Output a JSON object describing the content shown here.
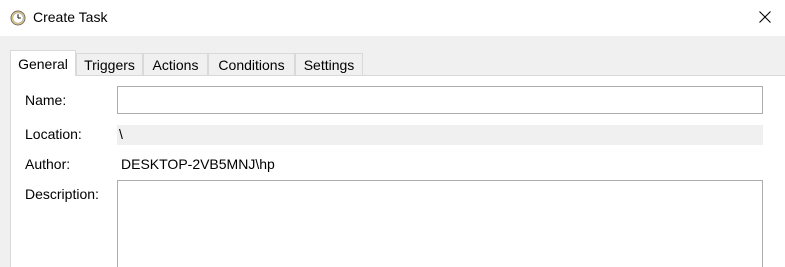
{
  "window": {
    "title": "Create Task",
    "icon": "task-scheduler-clock-icon",
    "close_icon": "close-icon"
  },
  "tabs": [
    {
      "label": "General",
      "active": true
    },
    {
      "label": "Triggers",
      "active": false
    },
    {
      "label": "Actions",
      "active": false
    },
    {
      "label": "Conditions",
      "active": false
    },
    {
      "label": "Settings",
      "active": false
    }
  ],
  "general": {
    "name_label": "Name:",
    "name_value": "",
    "location_label": "Location:",
    "location_value": "\\",
    "author_label": "Author:",
    "author_value": "DESKTOP-2VB5MNJ\\hp",
    "description_label": "Description:",
    "description_value": ""
  },
  "colors": {
    "window_background": "#f0f0f0",
    "panel_background": "#ffffff",
    "border": "#d9d9d9",
    "input_border": "#adadad"
  }
}
